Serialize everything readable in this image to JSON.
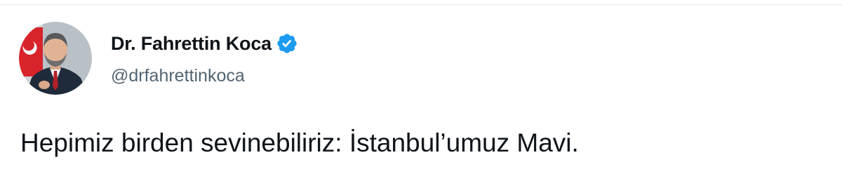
{
  "tweet": {
    "author": {
      "display_name": "Dr. Fahrettin Koca",
      "handle": "@drfahrettinkoca",
      "verified": true,
      "avatar_icon": "avatar-photo",
      "verified_icon": "verified-badge-icon"
    },
    "text": "Hepimiz birden sevinebiliriz: İstanbul’umuz Mavi."
  },
  "colors": {
    "text_primary": "#0f1419",
    "text_secondary": "#536471",
    "verified_blue": "#1d9bf0",
    "border": "#e7e9ea"
  }
}
